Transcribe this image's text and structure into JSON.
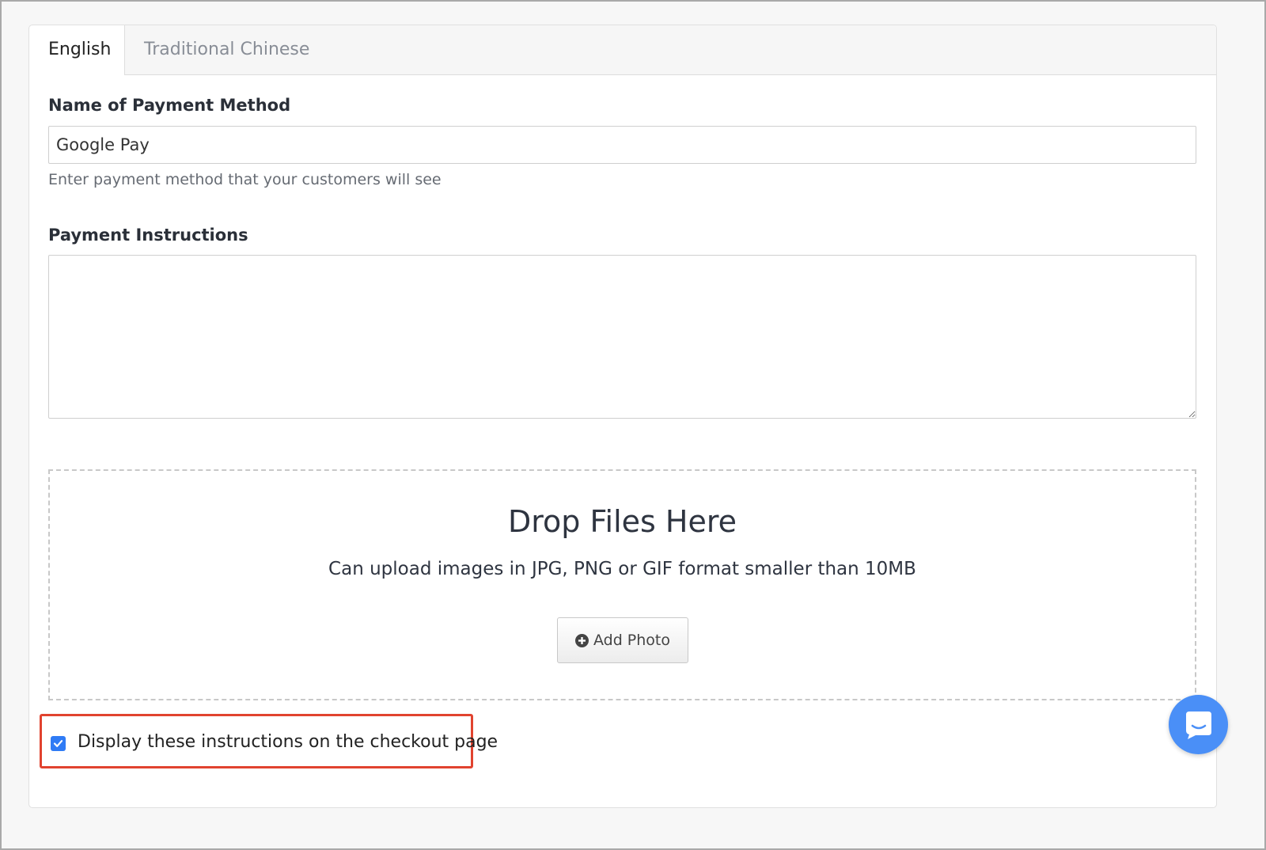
{
  "tabs": [
    {
      "label": "English",
      "active": true
    },
    {
      "label": "Traditional Chinese",
      "active": false
    }
  ],
  "payment_name": {
    "label": "Name of Payment Method",
    "value": "Google Pay",
    "help": "Enter payment method that your customers will see"
  },
  "instructions": {
    "label": "Payment Instructions",
    "value": ""
  },
  "dropzone": {
    "title": "Drop Files Here",
    "subtitle": "Can upload images in JPG, PNG or GIF format smaller than 10MB",
    "button_label": "Add Photo",
    "button_icon": "plus-circle-icon"
  },
  "display_checkbox": {
    "label": "Display these instructions on the checkout page",
    "checked": true,
    "highlight_color": "#e1432f"
  },
  "chat_widget": {
    "icon": "chat-icon",
    "color": "#4a8ff7"
  },
  "colors": {
    "accent": "#2f7bf5",
    "border": "#cfcfcf",
    "muted_text": "#888d96"
  }
}
